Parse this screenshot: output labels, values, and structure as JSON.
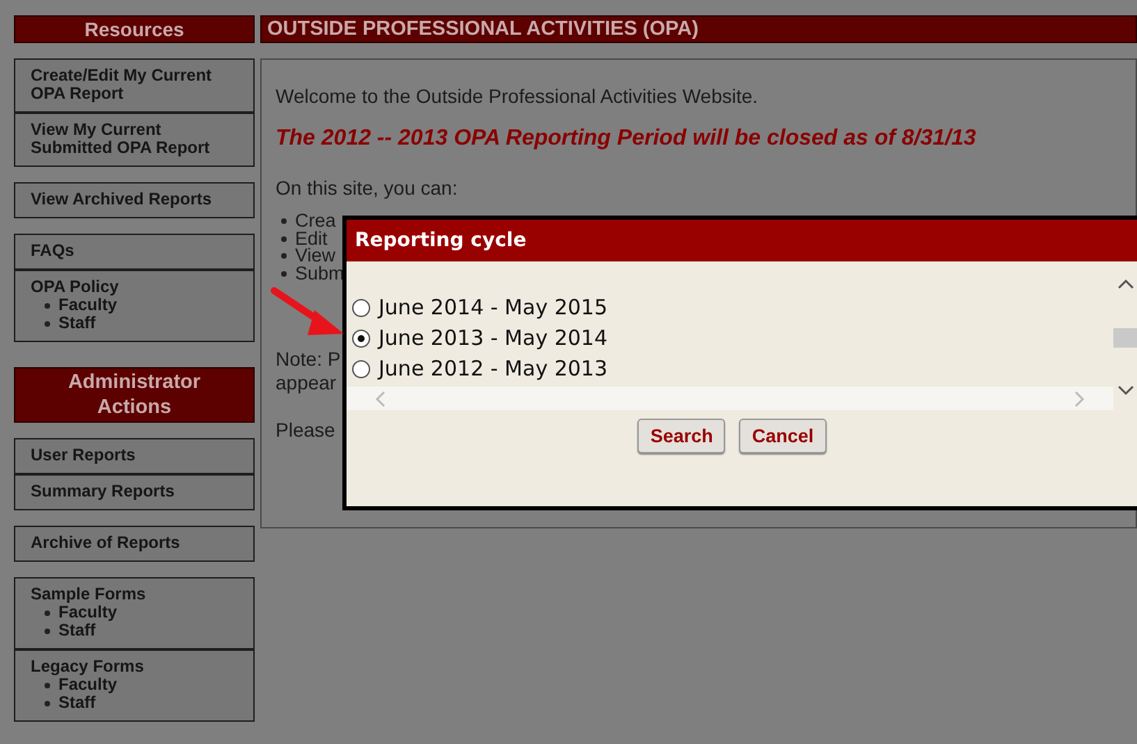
{
  "sidebar": [
    {
      "kind": "header",
      "title": "Resources"
    },
    {
      "kind": "group",
      "items": [
        {
          "label": "Create/Edit My Current OPA Report"
        },
        {
          "label": "View My Current Submitted OPA Report"
        }
      ]
    },
    {
      "kind": "group",
      "items": [
        {
          "label": "View Archived Reports"
        }
      ]
    },
    {
      "kind": "group",
      "items": [
        {
          "label": "FAQs"
        },
        {
          "label": "OPA Policy",
          "children": [
            {
              "label": "Faculty"
            },
            {
              "label": "Staff"
            }
          ]
        }
      ]
    },
    {
      "kind": "header",
      "title": "Administrator Actions"
    },
    {
      "kind": "group",
      "items": [
        {
          "label": "User Reports"
        },
        {
          "label": "Summary Reports"
        }
      ]
    },
    {
      "kind": "group",
      "items": [
        {
          "label": "Archive of Reports"
        }
      ]
    },
    {
      "kind": "group",
      "items": [
        {
          "label": "Sample Forms",
          "children": [
            {
              "label": "Faculty"
            },
            {
              "label": "Staff"
            }
          ]
        },
        {
          "label": "Legacy Forms",
          "children": [
            {
              "label": "Faculty"
            },
            {
              "label": "Staff"
            }
          ]
        }
      ]
    }
  ],
  "main": {
    "title": "OUTSIDE PROFESSIONAL ACTIVITIES (OPA)",
    "welcome": "Welcome to the Outside Professional Activities Website.",
    "notice": "The 2012 -- 2013 OPA Reporting Period will be closed as of 8/31/13",
    "intro": "On this site, you can:",
    "bullets": [
      "Crea",
      "Edit",
      "View",
      "Subm"
    ],
    "note_lines": [
      "Note: P",
      "appear"
    ],
    "closing": "Please"
  },
  "dialog": {
    "title": "Reporting cycle",
    "options": [
      {
        "label": "June 2014 - May 2015",
        "selected": false
      },
      {
        "label": "June 2013 - May 2014",
        "selected": true
      },
      {
        "label": "June 2012 - May 2013",
        "selected": false
      }
    ],
    "buttons": [
      "Search",
      "Cancel"
    ]
  }
}
